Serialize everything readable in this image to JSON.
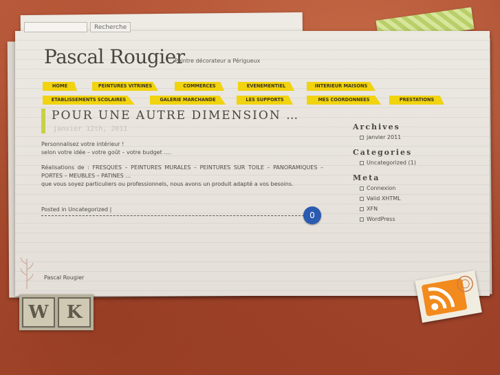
{
  "search": {
    "placeholder": "",
    "value": "",
    "button": "Recherche"
  },
  "header": {
    "title": "Pascal Rougier",
    "description": "Peintre décorateur a Périgueux"
  },
  "nav": {
    "row1": [
      {
        "label": "HOME"
      },
      {
        "label": "PEINTURES VITRINES"
      },
      {
        "label": "COMMERCES"
      },
      {
        "label": "EVENEMENTIEL"
      },
      {
        "label": "INTERIEUR MAISONS"
      }
    ],
    "row2": [
      {
        "label": "ETABLISSEMENTS SCOLAIRES"
      },
      {
        "label": "GALERIE MARCHANDE"
      },
      {
        "label": "LES SUPPORTS"
      },
      {
        "label": "MES COORDONNEES"
      },
      {
        "label": "PRESTATIONS"
      }
    ]
  },
  "post": {
    "title": "POUR UNE AUTRE DIMENSION …",
    "date": "janvier 12th, 2011",
    "paragraph1_line1": "Personnalisez votre intérieur !",
    "paragraph1_line2": "selon votre idée – votre goût – votre budget ….",
    "paragraph2_line1": "Réalisations de : FRESQUES – PEINTURES MURALES – PEINTURES SUR TOILE – PANORAMIQUES – PORTES – MEUBLES – PATINES …",
    "paragraph2_line2": "que vous soyez particuliers ou professionnels, nous avons un produit adapté a vos besoins.",
    "posted_in": "Posted in",
    "category": "Uncategorized",
    "separator": "|",
    "comments": "0"
  },
  "sidebar": {
    "archives_title": "Archives",
    "archives": [
      "janvier 2011"
    ],
    "categories_title": "Categories",
    "categories": [
      "Uncategorized (1)"
    ],
    "meta_title": "Meta",
    "meta": [
      "Connexion",
      "Valid XHTML",
      "XFN",
      "WordPress"
    ]
  },
  "footer": {
    "text": "Pascal Rougier"
  },
  "stamps": {
    "wp_letters": [
      "W",
      "K"
    ]
  },
  "colors": {
    "nav_yellow": "#f1d30f",
    "accent_green": "#c9d046",
    "comment_blue": "#2a5bb0",
    "rss_orange": "#f28a1d"
  }
}
